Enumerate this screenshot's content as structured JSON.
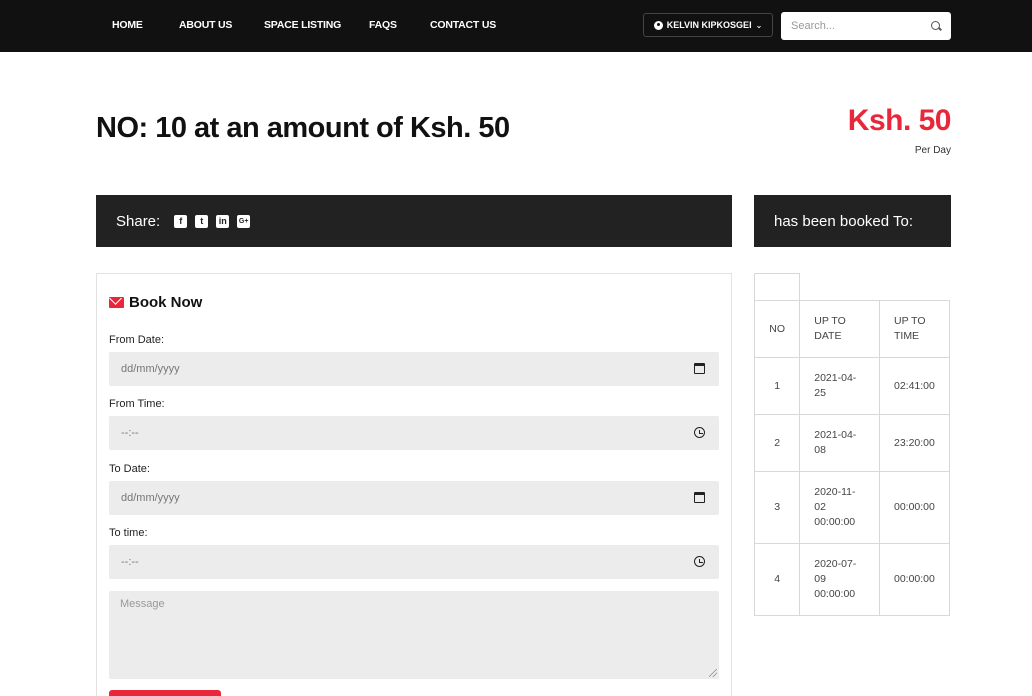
{
  "nav": {
    "home": "HOME",
    "about": "ABOUT US",
    "space_listing": "SPACE LISTING",
    "faqs": "FAQS",
    "contact": "CONTACT US",
    "user_name": "KELVIN KIPKOSGEI",
    "search_placeholder": "Search..."
  },
  "listing": {
    "title": "NO: 10 at an amount of Ksh. 50",
    "price": "Ksh. 50",
    "price_unit": "Per Day"
  },
  "share": {
    "label": "Share:",
    "icons": [
      "facebook-icon",
      "twitter-icon",
      "linkedin-icon",
      "google-plus-icon"
    ]
  },
  "booked_heading": "has been booked To:",
  "form": {
    "heading": "Book Now",
    "from_date_label": "From Date:",
    "from_date_placeholder": "dd/mm/yyyy",
    "from_time_label": "From Time:",
    "from_time_placeholder": "--:--",
    "to_date_label": "To Date:",
    "to_date_placeholder": "dd/mm/yyyy",
    "to_time_label": "To time:",
    "to_time_placeholder": "--:--",
    "message_placeholder": "Message"
  },
  "bookings": {
    "headers": [
      "NO",
      "UP TO DATE",
      "UP TO TIME"
    ],
    "rows": [
      {
        "no": "1",
        "date": "2021-04-25",
        "time": "02:41:00"
      },
      {
        "no": "2",
        "date": "2021-04-08",
        "time": "23:20:00"
      },
      {
        "no": "3",
        "date": "2020-11-02 00:00:00",
        "time": "00:00:00"
      },
      {
        "no": "4",
        "date": "2020-07-09 00:00:00",
        "time": "00:00:00"
      }
    ]
  },
  "colors": {
    "accent": "#e8283a",
    "nav_bg": "#111111",
    "bar_bg": "#222222"
  }
}
